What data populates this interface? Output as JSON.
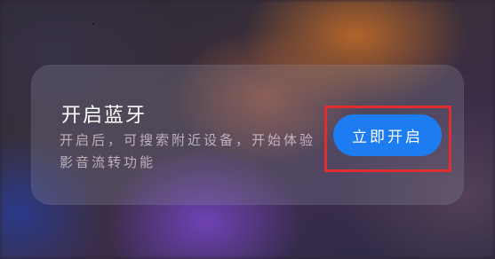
{
  "card": {
    "title": "开启蓝牙",
    "description": "开启后，可搜索附近设备，开始体验影音流转功能",
    "button_label": "立即开启"
  },
  "colors": {
    "button": "#1e7cf2",
    "highlight_box": "#e02e2e",
    "title_text": "#ffffff"
  }
}
